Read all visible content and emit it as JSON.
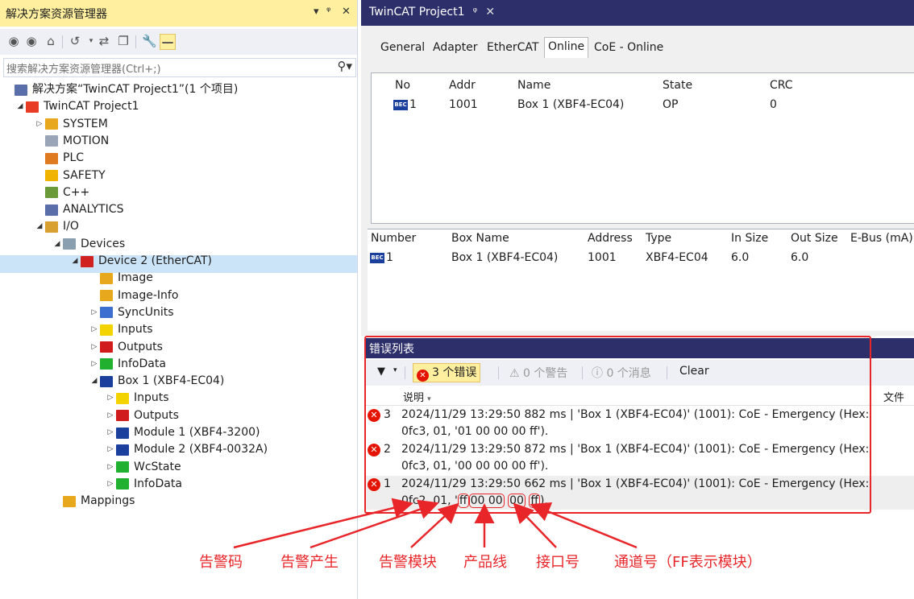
{
  "solution_explorer": {
    "title": "解决方案资源管理器",
    "title_controls": [
      "▾",
      "ᵠ",
      "✕"
    ],
    "search_placeholder": "搜索解决方案资源管理器(Ctrl+;)",
    "tree": [
      {
        "label": "解决方案“TwinCAT Project1”(1 个项目)",
        "indent": 0,
        "arrow": "",
        "icon": "solution-icon",
        "color": "#5a6eaa"
      },
      {
        "label": "TwinCAT Project1",
        "indent": 1,
        "arrow": "◢",
        "icon": "project-icon",
        "color": "#e83c25"
      },
      {
        "label": "SYSTEM",
        "indent": 2,
        "arrow": "▷",
        "icon": "system-icon",
        "color": "#e8a81e"
      },
      {
        "label": "MOTION",
        "indent": 2,
        "arrow": "",
        "icon": "motion-icon",
        "color": "#9aa6b8"
      },
      {
        "label": "PLC",
        "indent": 2,
        "arrow": "",
        "icon": "plc-icon",
        "color": "#e07a20"
      },
      {
        "label": "SAFETY",
        "indent": 2,
        "arrow": "",
        "icon": "safety-icon",
        "color": "#f0b400"
      },
      {
        "label": "C++",
        "indent": 2,
        "arrow": "",
        "icon": "cpp-icon",
        "color": "#6a9a3a"
      },
      {
        "label": "ANALYTICS",
        "indent": 2,
        "arrow": "",
        "icon": "analytics-icon",
        "color": "#5a6eaa"
      },
      {
        "label": "I/O",
        "indent": 2,
        "arrow": "◢",
        "icon": "io-icon",
        "color": "#d8a030"
      },
      {
        "label": "Devices",
        "indent": 3,
        "arrow": "◢",
        "icon": "devices-icon",
        "color": "#8aa0b0"
      },
      {
        "label": "Device 2 (EtherCAT)",
        "indent": 4,
        "arrow": "◢",
        "icon": "ethercat-device-icon",
        "color": "#d02020"
      },
      {
        "label": "Image",
        "indent": 5,
        "arrow": "",
        "icon": "image-icon",
        "color": "#e8a81e"
      },
      {
        "label": "Image-Info",
        "indent": 5,
        "arrow": "",
        "icon": "image-info-icon",
        "color": "#e8a81e"
      },
      {
        "label": "SyncUnits",
        "indent": 5,
        "arrow": "▷",
        "icon": "syncunits-icon",
        "color": "#3c6fd0"
      },
      {
        "label": "Inputs",
        "indent": 5,
        "arrow": "▷",
        "icon": "inputs-icon",
        "color": "#f3d400"
      },
      {
        "label": "Outputs",
        "indent": 5,
        "arrow": "▷",
        "icon": "outputs-icon",
        "color": "#d01c1c"
      },
      {
        "label": "InfoData",
        "indent": 5,
        "arrow": "▷",
        "icon": "infodata-icon",
        "color": "#22b030"
      },
      {
        "label": "Box 1 (XBF4-EC04)",
        "indent": 5,
        "arrow": "◢",
        "icon": "box-icon",
        "color": "#1a3f9c"
      },
      {
        "label": "Inputs",
        "indent": 6,
        "arrow": "▷",
        "icon": "inputs-icon",
        "color": "#f3d400"
      },
      {
        "label": "Outputs",
        "indent": 6,
        "arrow": "▷",
        "icon": "outputs-icon",
        "color": "#d01c1c"
      },
      {
        "label": "Module 1 (XBF4-3200)",
        "indent": 6,
        "arrow": "▷",
        "icon": "module-icon",
        "color": "#1a3f9c"
      },
      {
        "label": "Module 2 (XBF4-0032A)",
        "indent": 6,
        "arrow": "▷",
        "icon": "module-icon",
        "color": "#1a3f9c"
      },
      {
        "label": "WcState",
        "indent": 6,
        "arrow": "▷",
        "icon": "wcstate-icon",
        "color": "#22b030"
      },
      {
        "label": "InfoData",
        "indent": 6,
        "arrow": "▷",
        "icon": "infodata-icon",
        "color": "#22b030"
      },
      {
        "label": "Mappings",
        "indent": 3,
        "arrow": "",
        "icon": "mappings-icon",
        "color": "#e8a81e"
      }
    ]
  },
  "document": {
    "tab_title": "TwinCAT Project1",
    "tabs": [
      "General",
      "Adapter",
      "EtherCAT",
      "Online",
      "CoE - Online"
    ],
    "online_headers": [
      "No",
      "Addr",
      "Name",
      "State",
      "CRC"
    ],
    "online_row": {
      "no": "1",
      "addr": "1001",
      "name": "Box 1 (XBF4-EC04)",
      "state": "OP",
      "crc": "0"
    },
    "box_headers": [
      "Number",
      "Box Name",
      "Address",
      "Type",
      "In Size",
      "Out Size",
      "E-Bus (mA)"
    ],
    "box_row": {
      "number": "1",
      "name": "Box 1 (XBF4-EC04)",
      "address": "1001",
      "type": "XBF4-EC04",
      "in_size": "6.0",
      "out_size": "6.0"
    }
  },
  "error_list": {
    "title": "错误列表",
    "errors_label": "3 个错误",
    "warnings_label": "0 个警告",
    "messages_label": "0 个消息",
    "clear_label": "Clear",
    "col_description": "说明",
    "col_file": "文件",
    "rows": [
      {
        "num": "3",
        "line1": "2024/11/29 13:29:50 882 ms | 'Box 1 (XBF4-EC04)' (1001): CoE - Emergency (Hex:",
        "line2": "0fc3, 01, '01 00 00 00 ff')."
      },
      {
        "num": "2",
        "line1": "2024/11/29 13:29:50 872 ms | 'Box 1 (XBF4-EC04)' (1001): CoE - Emergency (Hex:",
        "line2": "0fc3, 01, '00 00 00 00 ff')."
      },
      {
        "num": "1",
        "line1": "2024/11/29 13:29:50 662 ms | 'Box 1 (XBF4-EC04)' (1001): CoE - Emergency (Hex:",
        "line2_parts": [
          "0fc2, 01, '",
          "ff",
          "00 00",
          "00",
          "ff",
          ")."
        ]
      }
    ]
  },
  "annotations": [
    "告警码",
    "告警产生",
    "告警模块",
    "产品线",
    "接口号",
    "通道号（FF表示模块）"
  ],
  "colors": {
    "accent_yellow": "#ffef9f",
    "tab_navy": "#2d2f6b",
    "annotation_red": "#e8262a",
    "selection": "#cce4f7"
  }
}
